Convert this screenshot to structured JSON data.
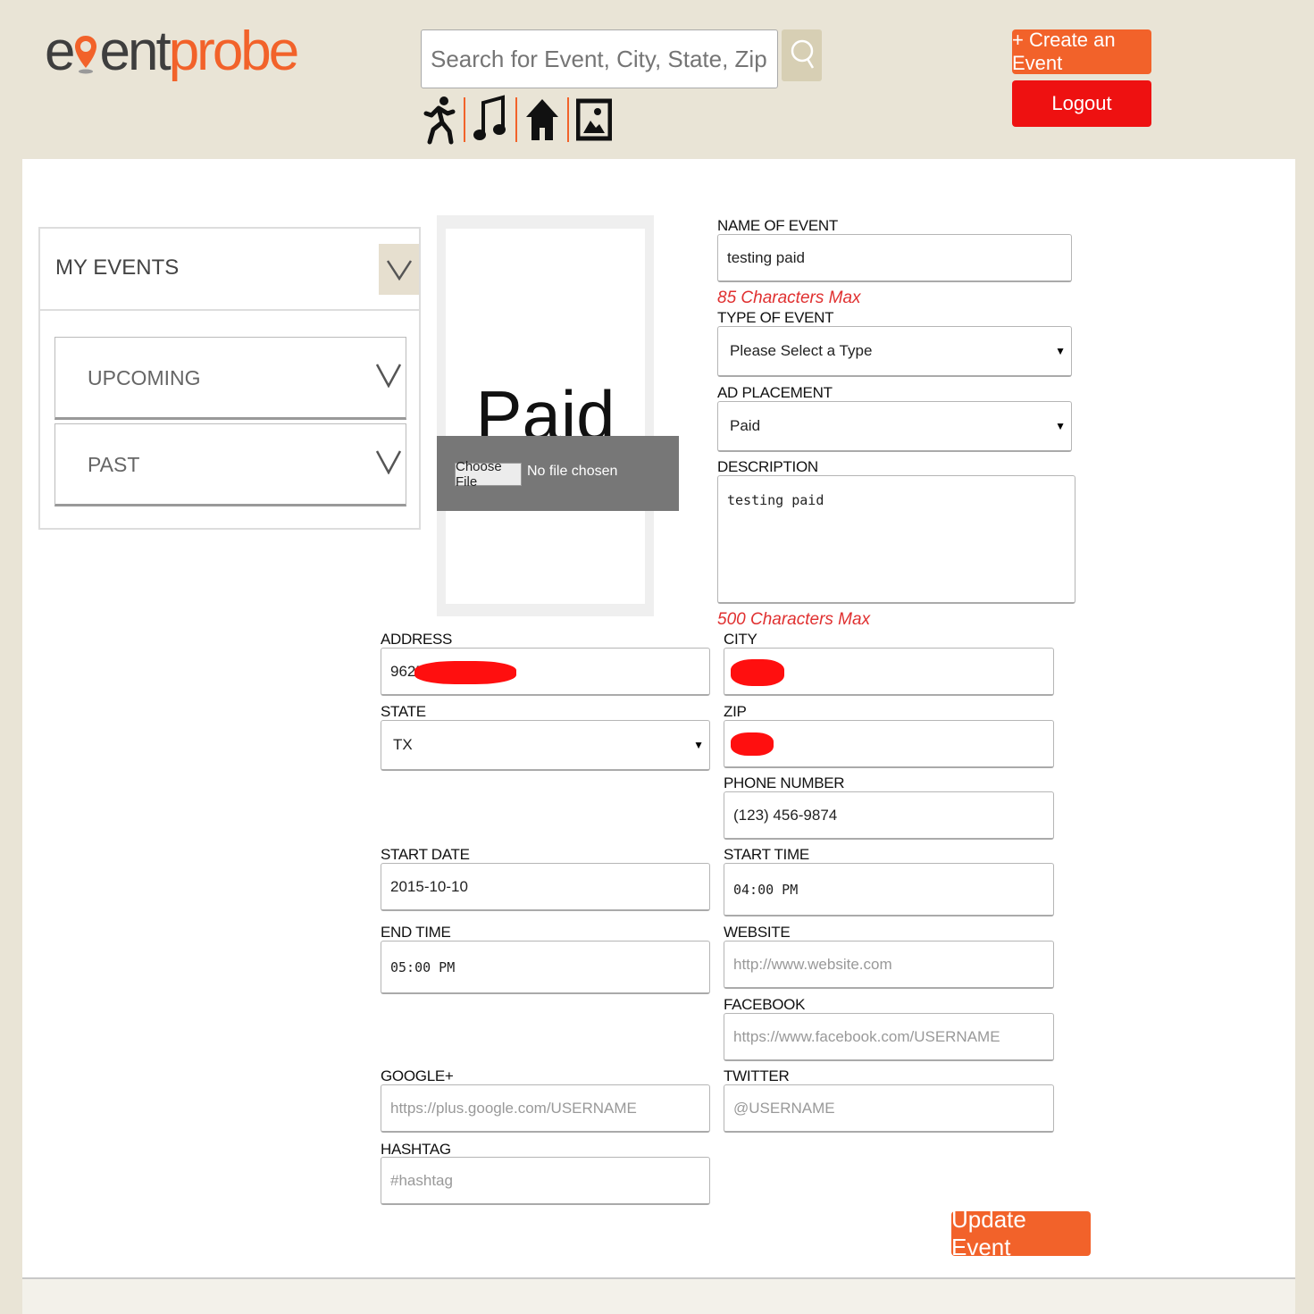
{
  "header": {
    "logo_part1": "e",
    "logo_part2": "ent",
    "logo_part3": "probe",
    "search_placeholder": "Search for Event, City, State, Zip Code",
    "create_label": "+ Create an Event",
    "logout_label": "Logout"
  },
  "sidebar": {
    "title": "MY EVENTS",
    "items": [
      {
        "label": "UPCOMING"
      },
      {
        "label": "PAST"
      }
    ]
  },
  "preview": {
    "text": "Paid",
    "choose_label": "Choose File",
    "no_file": "No file chosen"
  },
  "form": {
    "name_label": "NAME OF EVENT",
    "name_value": "testing paid",
    "name_hint": "85 Characters Max",
    "type_label": "TYPE OF EVENT",
    "type_value": "Please Select a Type",
    "ad_label": "AD PLACEMENT",
    "ad_value": "Paid",
    "desc_label": "DESCRIPTION",
    "desc_value": "testing paid",
    "desc_hint": "500 Characters Max",
    "address_label": "ADDRESS",
    "address_value": "9625",
    "city_label": "CITY",
    "state_label": "STATE",
    "state_value": "TX",
    "zip_label": "ZIP",
    "phone_label": "PHONE NUMBER",
    "phone_value": "(123) 456-9874",
    "start_date_label": "START DATE",
    "start_date_value": "2015-10-10",
    "start_time_label": "START TIME",
    "start_time_value": "04:00 PM",
    "end_time_label": "END TIME",
    "end_time_value": "05:00 PM",
    "website_label": "WEBSITE",
    "website_placeholder": "http://www.website.com",
    "facebook_label": "FACEBOOK",
    "facebook_placeholder": "https://www.facebook.com/USERNAME",
    "google_label": "GOOGLE+",
    "google_placeholder": "https://plus.google.com/USERNAME",
    "twitter_label": "TWITTER",
    "twitter_placeholder": "@USERNAME",
    "hashtag_label": "HASHTAG",
    "hashtag_placeholder": "#hashtag",
    "submit_label": "Update Event"
  },
  "colors": {
    "brand_orange": "#f2622a",
    "logout_red": "#ee1111",
    "hint_red": "#e03030",
    "page_bg": "#e9e4d6"
  },
  "icons": [
    "search-icon",
    "sports-icon",
    "music-icon",
    "home-icon",
    "image-icon",
    "chevron-down-icon"
  ]
}
